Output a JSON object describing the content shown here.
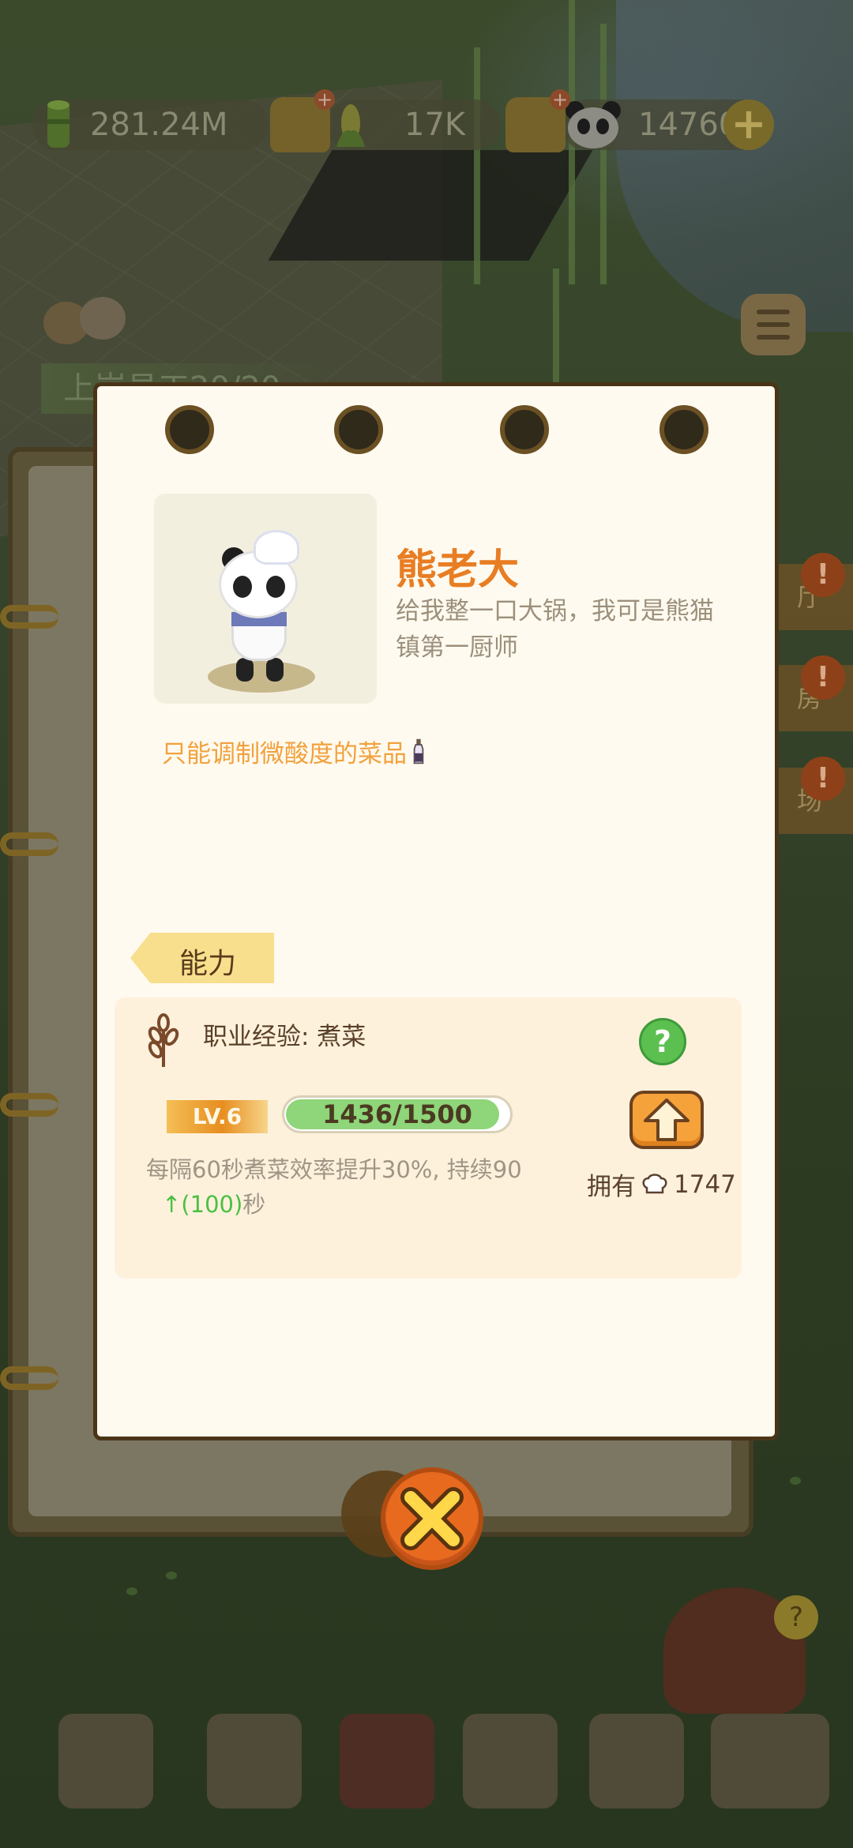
{
  "resources": {
    "bamboo_amount": "281.24M",
    "corn_amount": "17K",
    "panda_count": "14760"
  },
  "hud": {
    "staff_label": "上岗员工20/20"
  },
  "side_tabs": {
    "tab1": "厅",
    "tab2": "房",
    "tab3": "场",
    "badge": "!"
  },
  "character": {
    "name": "熊老大",
    "description": "给我整一口大锅，我可是熊猫镇第一厨师",
    "trait": "只能调制微酸度的菜品"
  },
  "ability": {
    "tag": "能力",
    "exp_label": "职业经验:  煮菜",
    "help": "?",
    "level": "LV.6",
    "exp_current": 1436,
    "exp_max": 1500,
    "exp_text": "1436/1500",
    "effect_text": "每隔60秒煮菜效率提升30%, 持续90",
    "effect_up": "↑(100)",
    "effect_unit": "秒",
    "owned_label": "拥有",
    "owned_count": "1747"
  },
  "icons": {
    "bamboo": "bamboo-icon",
    "corn": "corn-icon",
    "panda": "panda-icon",
    "close": "close-icon",
    "upgrade": "arrow-up-icon"
  },
  "colors": {
    "name": "#e87d23",
    "trait": "#f2a13d",
    "close": "#e86a1f",
    "exp_fill": "#8fd579"
  }
}
